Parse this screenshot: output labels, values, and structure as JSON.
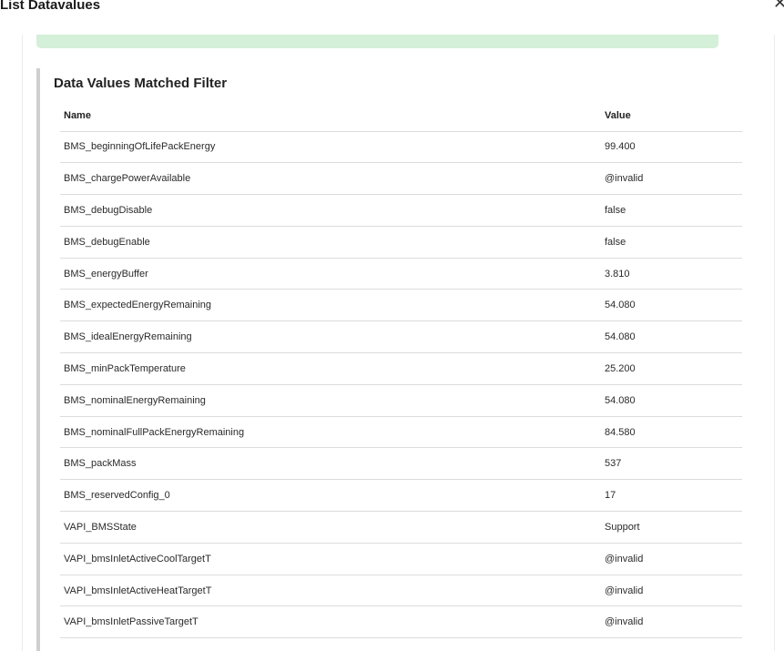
{
  "dialog": {
    "title": "List Datavalues",
    "close_glyph": "✕"
  },
  "panel": {
    "heading": "Data Values Matched Filter"
  },
  "table": {
    "columns": [
      "Name",
      "Value"
    ],
    "rows": [
      {
        "name": "BMS_beginningOfLifePackEnergy",
        "value": "99.400"
      },
      {
        "name": "BMS_chargePowerAvailable",
        "value": "@invalid"
      },
      {
        "name": "BMS_debugDisable",
        "value": "false"
      },
      {
        "name": "BMS_debugEnable",
        "value": "false"
      },
      {
        "name": "BMS_energyBuffer",
        "value": "3.810"
      },
      {
        "name": "BMS_expectedEnergyRemaining",
        "value": "54.080"
      },
      {
        "name": "BMS_idealEnergyRemaining",
        "value": "54.080"
      },
      {
        "name": "BMS_minPackTemperature",
        "value": "25.200"
      },
      {
        "name": "BMS_nominalEnergyRemaining",
        "value": "54.080"
      },
      {
        "name": "BMS_nominalFullPackEnergyRemaining",
        "value": "84.580"
      },
      {
        "name": "BMS_packMass",
        "value": "537"
      },
      {
        "name": "BMS_reservedConfig_0",
        "value": "17"
      },
      {
        "name": "VAPI_BMSState",
        "value": "Support"
      },
      {
        "name": "VAPI_bmsInletActiveCoolTargetT",
        "value": "@invalid"
      },
      {
        "name": "VAPI_bmsInletActiveHeatTargetT",
        "value": "@invalid"
      },
      {
        "name": "VAPI_bmsInletPassiveTargetT",
        "value": "@invalid"
      }
    ]
  },
  "colors": {
    "success_banner": "#d5f0d8",
    "panel_accent": "#cfcfcf",
    "row_divider": "#dcdcdc"
  }
}
